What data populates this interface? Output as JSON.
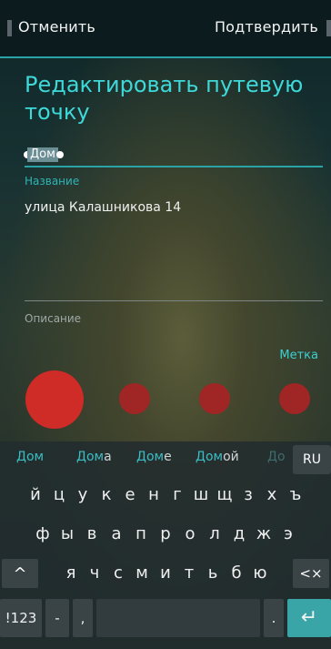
{
  "header": {
    "cancel_label": "Отменить",
    "confirm_label": "Подтвердить"
  },
  "page": {
    "title": "Редактировать путевую точку"
  },
  "input": {
    "value": "Дом"
  },
  "name_field": {
    "label": "Название",
    "value": "улица Калашникова 14"
  },
  "description_field": {
    "label": "Описание"
  },
  "marker": {
    "label": "Метка",
    "selected_color": "#cf2b27",
    "other_color": "#a02625"
  },
  "keyboard": {
    "suggestions": [
      {
        "prefix": "Дом",
        "suffix": ""
      },
      {
        "prefix": "Дом",
        "suffix": "а"
      },
      {
        "prefix": "Дом",
        "suffix": "е"
      },
      {
        "prefix": "Дом",
        "suffix": "ой"
      },
      {
        "prefix": "До",
        "suffix": ""
      }
    ],
    "language": "RU",
    "row1": [
      "й",
      "ц",
      "у",
      "к",
      "е",
      "н",
      "г",
      "ш",
      "щ",
      "з",
      "х",
      "ъ"
    ],
    "row2": [
      "ф",
      "ы",
      "в",
      "а",
      "п",
      "р",
      "о",
      "л",
      "д",
      "ж",
      "э"
    ],
    "row3": [
      "я",
      "ч",
      "с",
      "м",
      "и",
      "т",
      "ь",
      "б",
      "ю"
    ],
    "shift_symbol": "^",
    "backspace_symbol": "<×",
    "symbols_label": "!123",
    "dash_label": "-",
    "comma_label": ",",
    "period_label": ".",
    "enter_symbol": "↵"
  }
}
